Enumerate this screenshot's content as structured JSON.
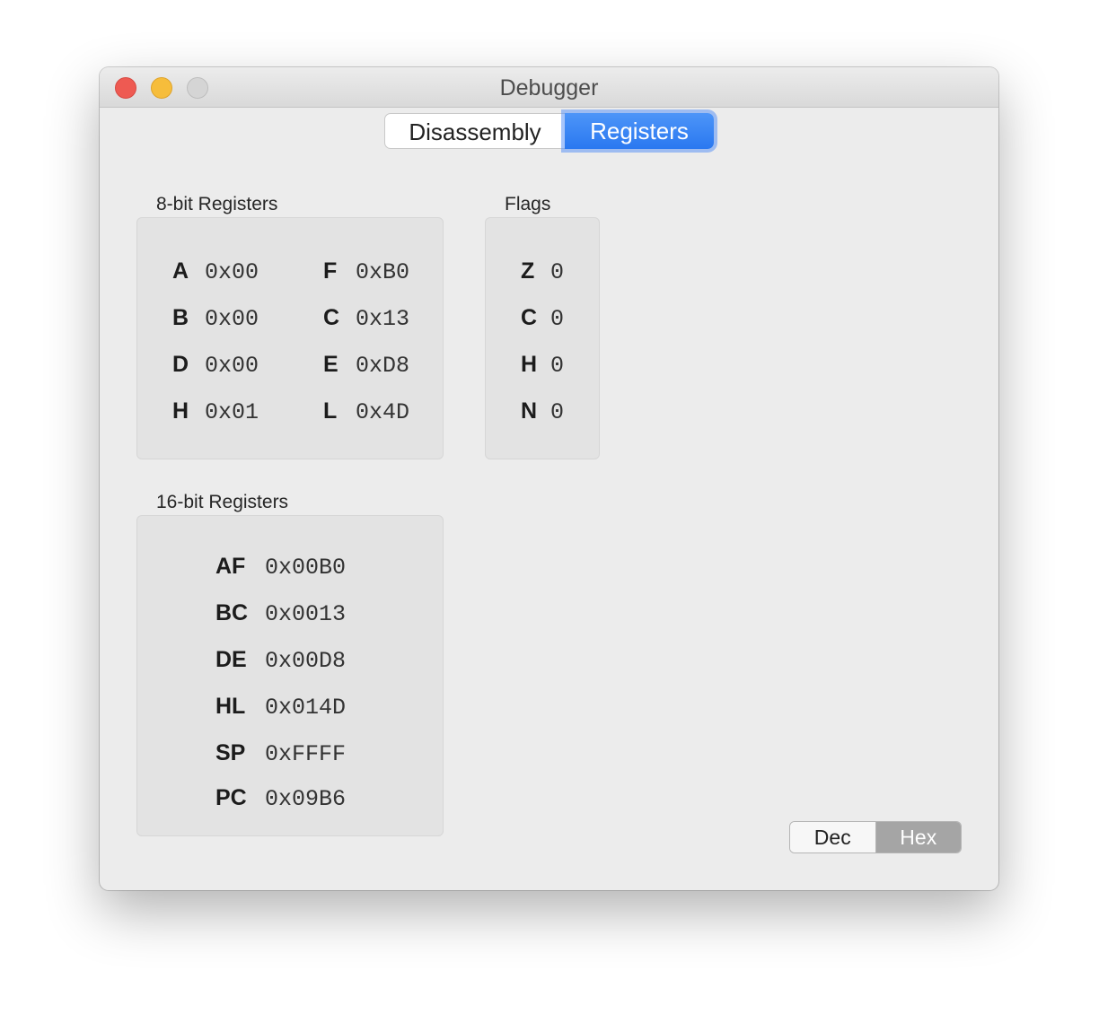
{
  "window": {
    "title": "Debugger"
  },
  "tabs": [
    {
      "label": "Disassembly",
      "selected": false
    },
    {
      "label": "Registers",
      "selected": true
    }
  ],
  "registers8": {
    "label": "8-bit Registers",
    "items": [
      {
        "name": "A",
        "value": "0x00"
      },
      {
        "name": "F",
        "value": "0xB0"
      },
      {
        "name": "B",
        "value": "0x00"
      },
      {
        "name": "C",
        "value": "0x13"
      },
      {
        "name": "D",
        "value": "0x00"
      },
      {
        "name": "E",
        "value": "0xD8"
      },
      {
        "name": "H",
        "value": "0x01"
      },
      {
        "name": "L",
        "value": "0x4D"
      }
    ]
  },
  "flags": {
    "label": "Flags",
    "items": [
      {
        "name": "Z",
        "value": "0"
      },
      {
        "name": "C",
        "value": "0"
      },
      {
        "name": "H",
        "value": "0"
      },
      {
        "name": "N",
        "value": "0"
      }
    ]
  },
  "registers16": {
    "label": "16-bit Registers",
    "items": [
      {
        "name": "AF",
        "value": "0x00B0"
      },
      {
        "name": "BC",
        "value": "0x0013"
      },
      {
        "name": "DE",
        "value": "0x00D8"
      },
      {
        "name": "HL",
        "value": "0x014D"
      },
      {
        "name": "SP",
        "value": "0xFFFF"
      },
      {
        "name": "PC",
        "value": "0x09B6"
      }
    ]
  },
  "format": {
    "dec_label": "Dec",
    "hex_label": "Hex",
    "selected": "Hex"
  }
}
